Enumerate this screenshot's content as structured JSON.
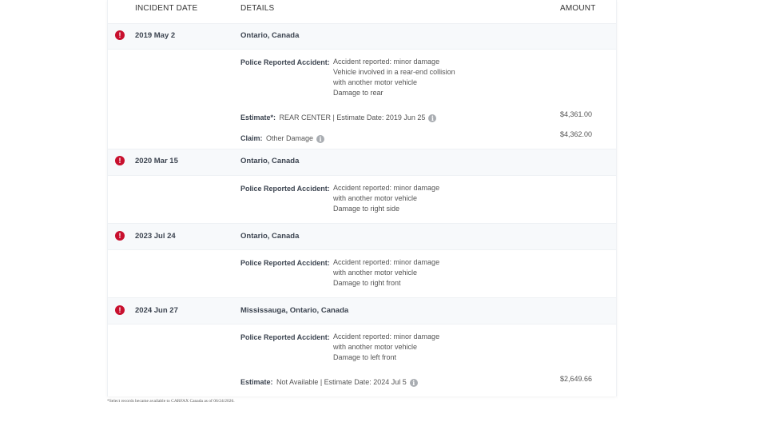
{
  "header": {
    "incident_date": "INCIDENT DATE",
    "details": "DETAILS",
    "amount": "AMOUNT"
  },
  "incidents": [
    {
      "date": "2019 May 2",
      "location": "Ontario, Canada",
      "police_label": "Police Reported Accident:",
      "police_lines": [
        "Accident reported: minor damage",
        "Vehicle involved in a rear-end collision",
        "with another motor vehicle",
        "Damage to rear"
      ],
      "estimate_label": "Estimate*:",
      "estimate_text": "REAR CENTER | Estimate Date: 2019 Jun 25",
      "estimate_amount": "$4,361.00",
      "claim_label": "Claim:",
      "claim_text": "Other Damage",
      "claim_amount": "$4,362.00"
    },
    {
      "date": "2020 Mar 15",
      "location": "Ontario, Canada",
      "police_label": "Police Reported Accident:",
      "police_lines": [
        "Accident reported: minor damage",
        "with another motor vehicle",
        "Damage to right side"
      ]
    },
    {
      "date": "2023 Jul 24",
      "location": "Ontario, Canada",
      "police_label": "Police Reported Accident:",
      "police_lines": [
        "Accident reported: minor damage",
        "with another motor vehicle",
        "Damage to right front"
      ]
    },
    {
      "date": "2024 Jun 27",
      "location": "Mississauga, Ontario, Canada",
      "police_label": "Police Reported Accident:",
      "police_lines": [
        "Accident reported: minor damage",
        "with another motor vehicle",
        "Damage to left front"
      ],
      "estimate_label": "Estimate:",
      "estimate_text": "Not Available | Estimate Date: 2024 Jul 5",
      "estimate_amount": "$2,649.66"
    }
  ],
  "icons": {
    "alert": "!",
    "info": "i"
  },
  "colors": {
    "alert": "#c8102e",
    "info": "#a9adb2",
    "band": "#f7f9fb"
  },
  "footnote": "*Select records became available to CARFAX Canada as of 06/24/2026."
}
